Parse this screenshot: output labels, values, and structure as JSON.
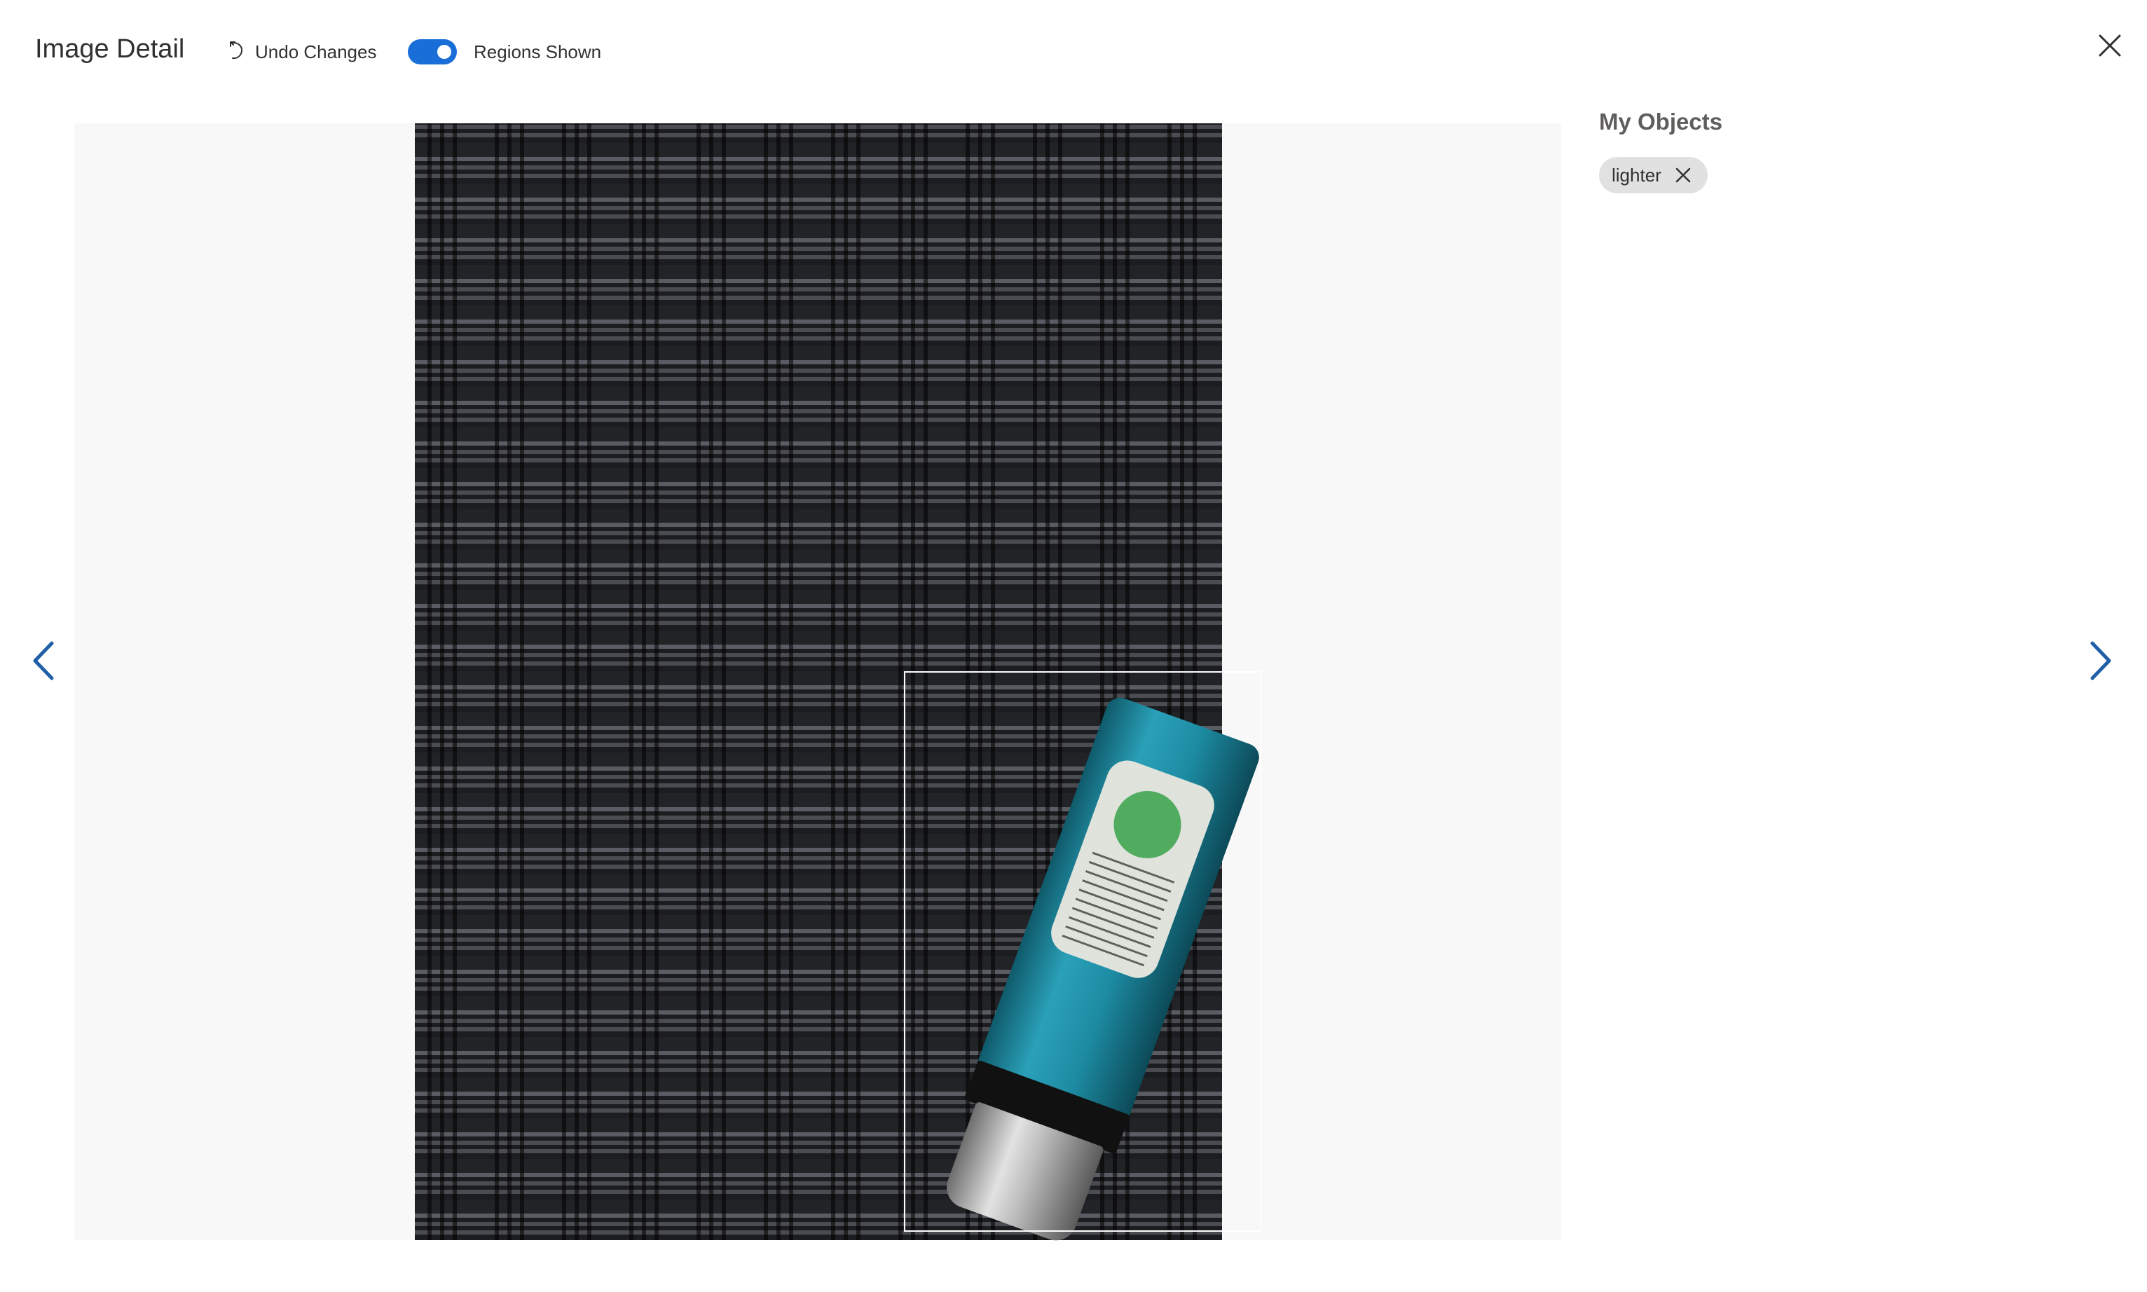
{
  "header": {
    "title": "Image Detail",
    "undo_label": "Undo Changes",
    "regions_toggle_label": "Regions Shown",
    "regions_toggle_on": true,
    "undo_icon": "undo-icon",
    "close_icon": "close-icon"
  },
  "navigation": {
    "prev_icon": "chevron-left-icon",
    "next_icon": "chevron-right-icon"
  },
  "objects_panel": {
    "heading": "My Objects",
    "tags": [
      {
        "label": "lighter",
        "remove_icon": "close-icon"
      }
    ]
  },
  "colors": {
    "accent": "#1a6ed8",
    "nav_arrow": "#1f5fa8",
    "chip_bg": "#e1e1e1",
    "viewer_bg": "#f8f8f8",
    "region_outline": "#ffffff"
  }
}
